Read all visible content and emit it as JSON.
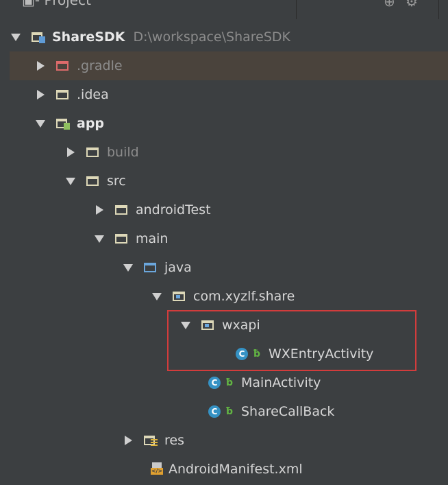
{
  "panel": {
    "title": "Project",
    "header_icons": [
      "globe-icon",
      "settings-icon"
    ]
  },
  "tree": [
    {
      "label": "ShareSDK",
      "path": "D:\\workspace\\ShareSDK",
      "icon": "module-folder-icon",
      "expanded": true,
      "bold": true
    },
    {
      "label": ".gradle",
      "icon": "folder-excluded-icon",
      "expanded": false,
      "selected": true
    },
    {
      "label": ".idea",
      "icon": "folder-icon",
      "expanded": false
    },
    {
      "label": "app",
      "icon": "android-module-icon",
      "expanded": true,
      "bold": true
    },
    {
      "label": "build",
      "icon": "folder-icon",
      "expanded": false,
      "dim": true
    },
    {
      "label": "src",
      "icon": "folder-icon",
      "expanded": true
    },
    {
      "label": "androidTest",
      "icon": "folder-icon",
      "expanded": false
    },
    {
      "label": "main",
      "icon": "folder-icon",
      "expanded": true
    },
    {
      "label": "java",
      "icon": "source-root-icon",
      "expanded": true
    },
    {
      "label": "com.xyzlf.share",
      "icon": "package-icon",
      "expanded": true
    },
    {
      "label": "wxapi",
      "icon": "package-icon",
      "expanded": true
    },
    {
      "label": "WXEntryActivity",
      "icon": "class-icon"
    },
    {
      "label": "MainActivity",
      "icon": "class-icon"
    },
    {
      "label": "ShareCallBack",
      "icon": "class-icon"
    },
    {
      "label": "res",
      "icon": "resource-folder-icon",
      "expanded": false
    },
    {
      "label": "AndroidManifest.xml",
      "icon": "xml-manifest-icon"
    }
  ],
  "colors": {
    "background": "#3c3f41",
    "selection": "#4a433c",
    "highlight_border": "#d23c3c",
    "class_icon": "#3592c4"
  }
}
